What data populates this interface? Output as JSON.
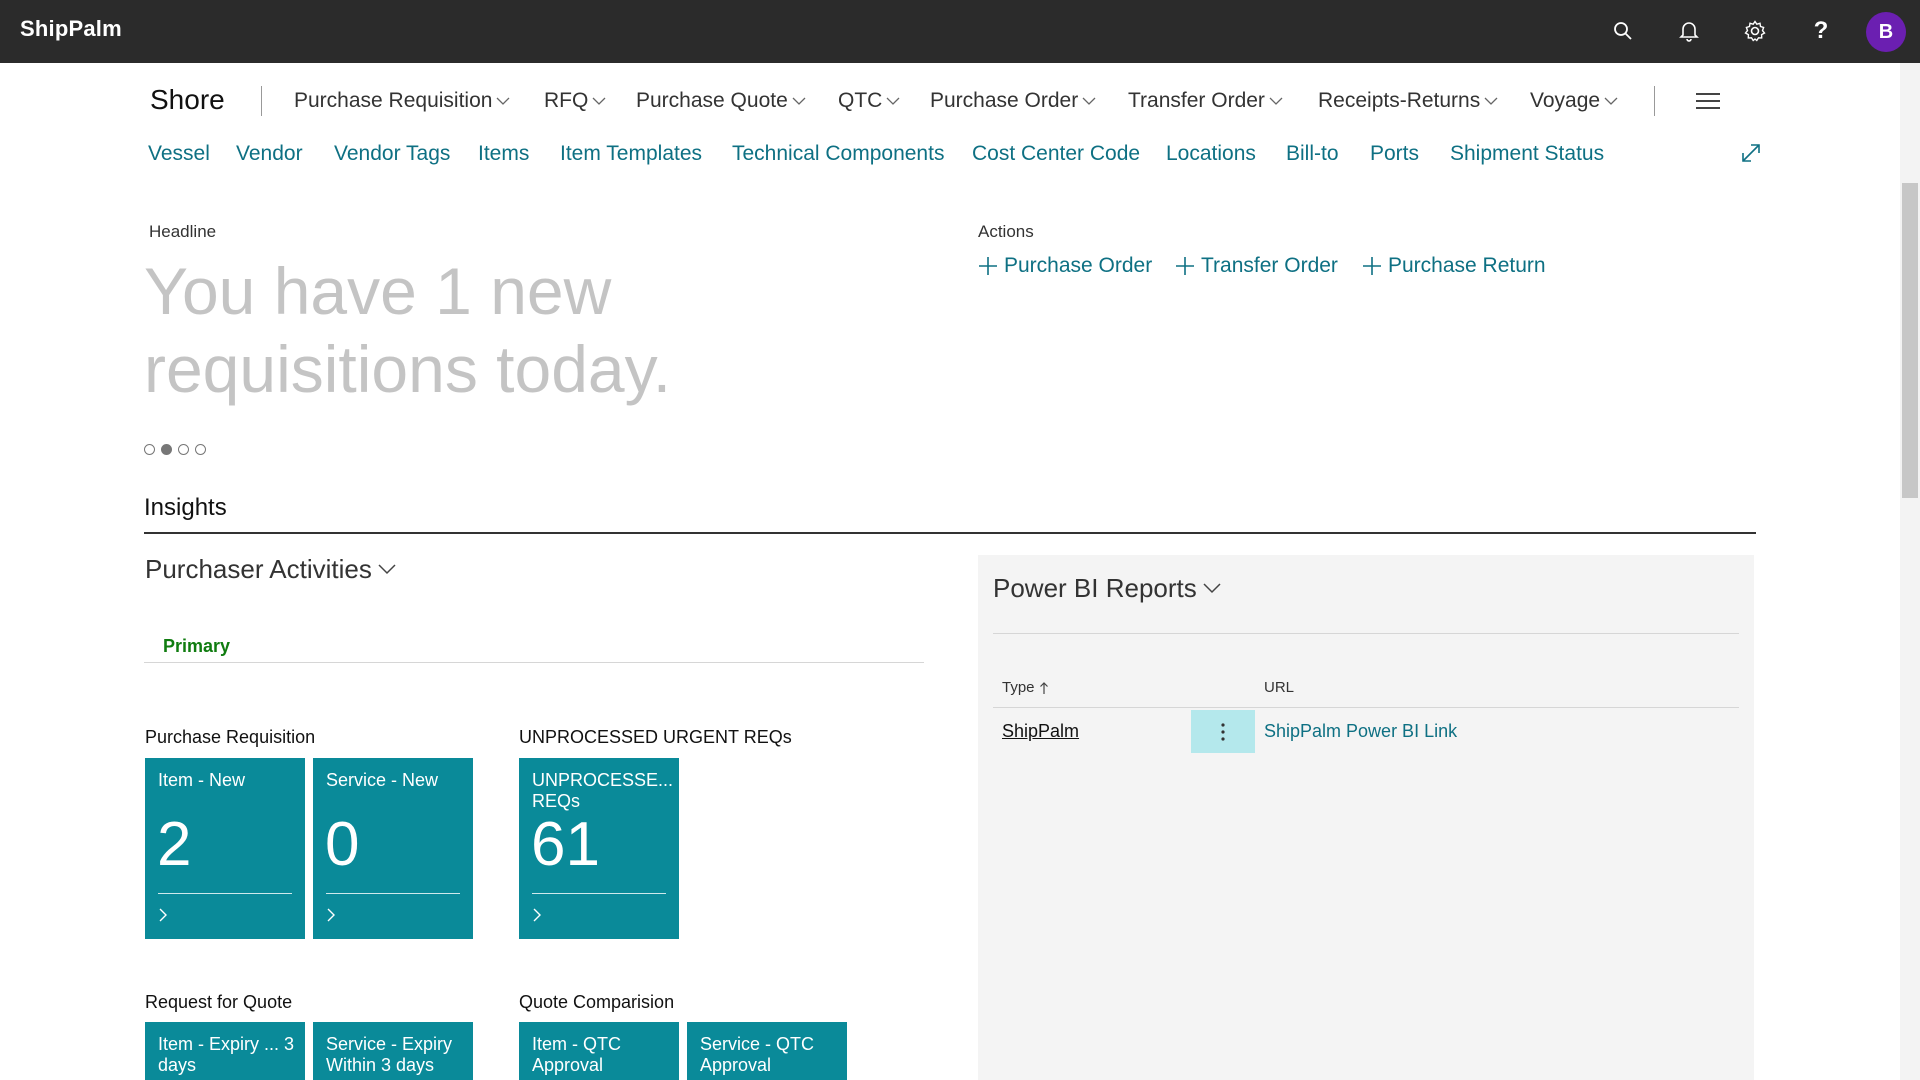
{
  "app": {
    "brand": "ShipPalm",
    "user_initial": "B",
    "accent_color": "#0a8a99",
    "link_color": "#0e7083",
    "icons": [
      "search-icon",
      "bell-icon",
      "gear-icon",
      "help-icon"
    ]
  },
  "nav": {
    "title": "Shore",
    "menus": [
      "Purchase Requisition",
      "RFQ",
      "Purchase Quote",
      "QTC",
      "Purchase Order",
      "Transfer Order",
      "Receipts-Returns",
      "Voyage"
    ],
    "links": [
      "Vessel",
      "Vendor",
      "Vendor Tags",
      "Items",
      "Item Templates",
      "Technical Components",
      "Cost Center Code",
      "Locations",
      "Bill-to",
      "Ports",
      "Shipment Status"
    ]
  },
  "headline": {
    "label": "Headline",
    "text": "You have 1 new requisitions today.",
    "active_dot": 2,
    "dot_count": 4
  },
  "actions": {
    "label": "Actions",
    "items": [
      "Purchase Order",
      "Transfer Order",
      "Purchase Return"
    ]
  },
  "insights": {
    "title": "Insights",
    "purchaser_activities": {
      "title": "Purchaser Activities",
      "tab": "Primary",
      "groups": [
        {
          "title": "Purchase Requisition",
          "tiles": [
            {
              "label": "Item - New",
              "value": "2"
            },
            {
              "label": "Service - New",
              "value": "0"
            }
          ]
        },
        {
          "title": "UNPROCESSED URGENT REQs",
          "tiles": [
            {
              "label": "UNPROCESSE... REQs",
              "value": "61"
            }
          ]
        },
        {
          "title": "Request for Quote",
          "tiles": [
            {
              "label": "Item - Expiry ... 3 days"
            },
            {
              "label": "Service - Expiry Within 3 days"
            }
          ]
        },
        {
          "title": "Quote Comparision",
          "tiles": [
            {
              "label": "Item - QTC Approval"
            },
            {
              "label": "Service - QTC Approval"
            }
          ]
        }
      ]
    },
    "power_bi": {
      "title": "Power BI Reports",
      "columns": {
        "type": "Type",
        "url": "URL"
      },
      "rows": [
        {
          "type": "ShipPalm",
          "url": "ShipPalm Power BI Link"
        }
      ]
    }
  }
}
